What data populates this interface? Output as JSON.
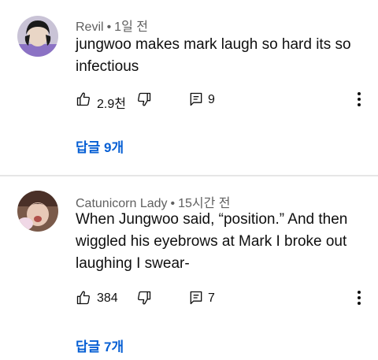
{
  "comments": [
    {
      "author": "Revil",
      "separator": "•",
      "time": "1일 전",
      "text": "jungwoo makes mark laugh so hard its so infectious",
      "like_count": "2.9천",
      "reply_count": "9",
      "replies_link": "답글 9개"
    },
    {
      "author": "Catunicorn Lady",
      "separator": "•",
      "time": "15시간 전",
      "text": "When Jungwoo said, “position.” And then wiggled his eyebrows at Mark I broke out laughing I swear-",
      "like_count": "384",
      "reply_count": "7",
      "replies_link": "답글 7개"
    }
  ],
  "icons": {
    "like": "thumb-up-icon",
    "dislike": "thumb-down-icon",
    "reply": "comment-icon",
    "more": "more-vert-icon"
  },
  "colors": {
    "link": "#065fd4",
    "meta": "#606060",
    "text": "#0f0f0f",
    "divider": "#e6e6e6"
  }
}
